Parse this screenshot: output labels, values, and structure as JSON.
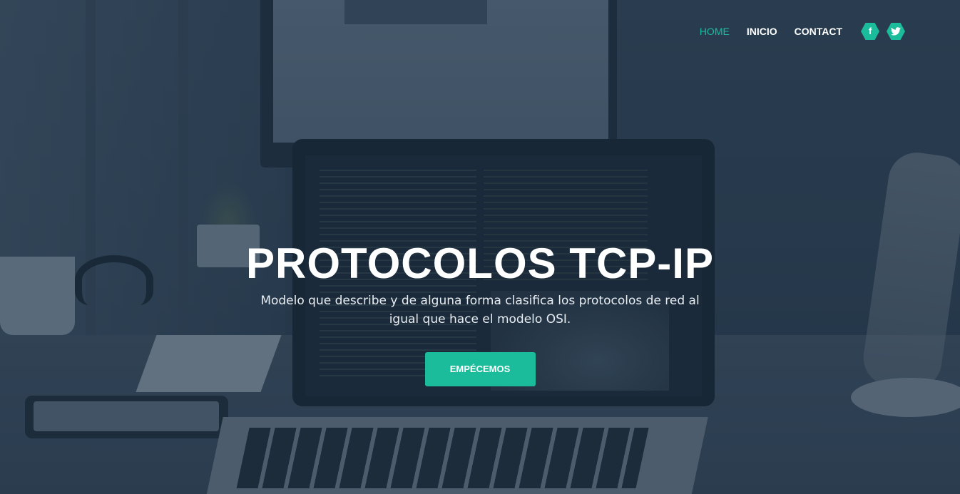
{
  "nav": {
    "items": [
      {
        "label": "HOME",
        "active": true
      },
      {
        "label": "INICIO",
        "active": false
      },
      {
        "label": "CONTACT",
        "active": false
      }
    ],
    "social": [
      {
        "icon": "facebook-icon",
        "glyph": "f"
      },
      {
        "icon": "twitter-icon"
      }
    ]
  },
  "hero": {
    "title": "PROTOCOLOS TCP-IP",
    "subtitle": "Modelo que describe y de alguna forma clasifica los protocolos de red al igual que hace el modelo OSI.",
    "cta_label": "EMPÉCEMOS"
  },
  "colors": {
    "accent": "#1abc9c",
    "overlay": "#1c2d40",
    "text": "#ffffff"
  }
}
